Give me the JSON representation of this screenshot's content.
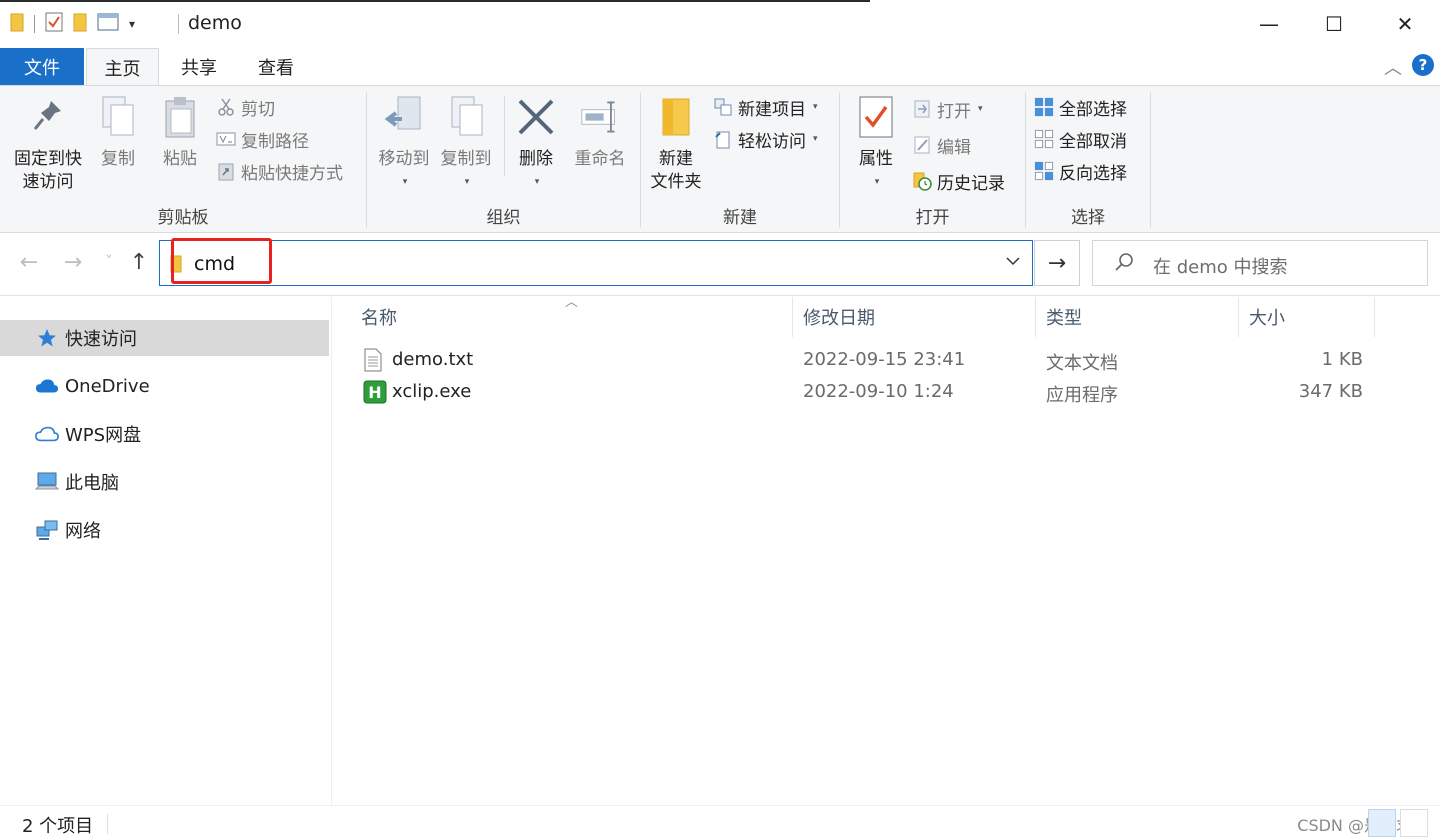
{
  "window": {
    "title": "demo",
    "controls": {
      "minimize": "—",
      "maximize": "☐",
      "close": "✕"
    }
  },
  "tabs": {
    "file": "文件",
    "home": "主页",
    "share": "共享",
    "view": "查看"
  },
  "ribbon": {
    "clipboard": {
      "label": "剪贴板",
      "pin_line1": "固定到快",
      "pin_line2": "速访问",
      "copy": "复制",
      "paste": "粘贴",
      "cut": "剪切",
      "copy_path": "复制路径",
      "paste_shortcut": "粘贴快捷方式"
    },
    "organize": {
      "label": "组织",
      "move_to": "移动到",
      "copy_to": "复制到",
      "delete": "删除",
      "rename": "重命名"
    },
    "new": {
      "label": "新建",
      "new_folder_line1": "新建",
      "new_folder_line2": "文件夹",
      "new_item": "新建项目",
      "easy_access": "轻松访问"
    },
    "open": {
      "label": "打开",
      "properties": "属性",
      "open": "打开",
      "edit": "编辑",
      "history": "历史记录"
    },
    "select": {
      "label": "选择",
      "select_all": "全部选择",
      "select_none": "全部取消",
      "invert": "反向选择"
    }
  },
  "nav": {
    "back": "←",
    "forward": "→",
    "recent": "˅",
    "up": "↑",
    "go": "→"
  },
  "address": {
    "value": "cmd"
  },
  "search": {
    "placeholder": "在 demo 中搜索"
  },
  "sidebar": {
    "items": [
      {
        "label": "快速访问",
        "icon": "star-icon"
      },
      {
        "label": "OneDrive",
        "icon": "cloud-icon"
      },
      {
        "label": "WPS网盘",
        "icon": "cloud-outline-icon"
      },
      {
        "label": "此电脑",
        "icon": "computer-icon"
      },
      {
        "label": "网络",
        "icon": "network-icon"
      }
    ]
  },
  "columns": {
    "name": "名称",
    "modified": "修改日期",
    "type": "类型",
    "size": "大小"
  },
  "files": [
    {
      "name": "demo.txt",
      "modified": "2022-09-15 23:41",
      "type": "文本文档",
      "size": "1 KB",
      "icon": "text-file-icon"
    },
    {
      "name": "xclip.exe",
      "modified": "2022-09-10 1:24",
      "type": "应用程序",
      "size": "347 KB",
      "icon": "exe-icon"
    }
  ],
  "status": {
    "count": "2 个项目",
    "watermark": "CSDN @是非求败"
  },
  "colors": {
    "accent": "#1a6fc9",
    "highlight_box": "#e8231f",
    "selection": "#d9d9d9"
  }
}
